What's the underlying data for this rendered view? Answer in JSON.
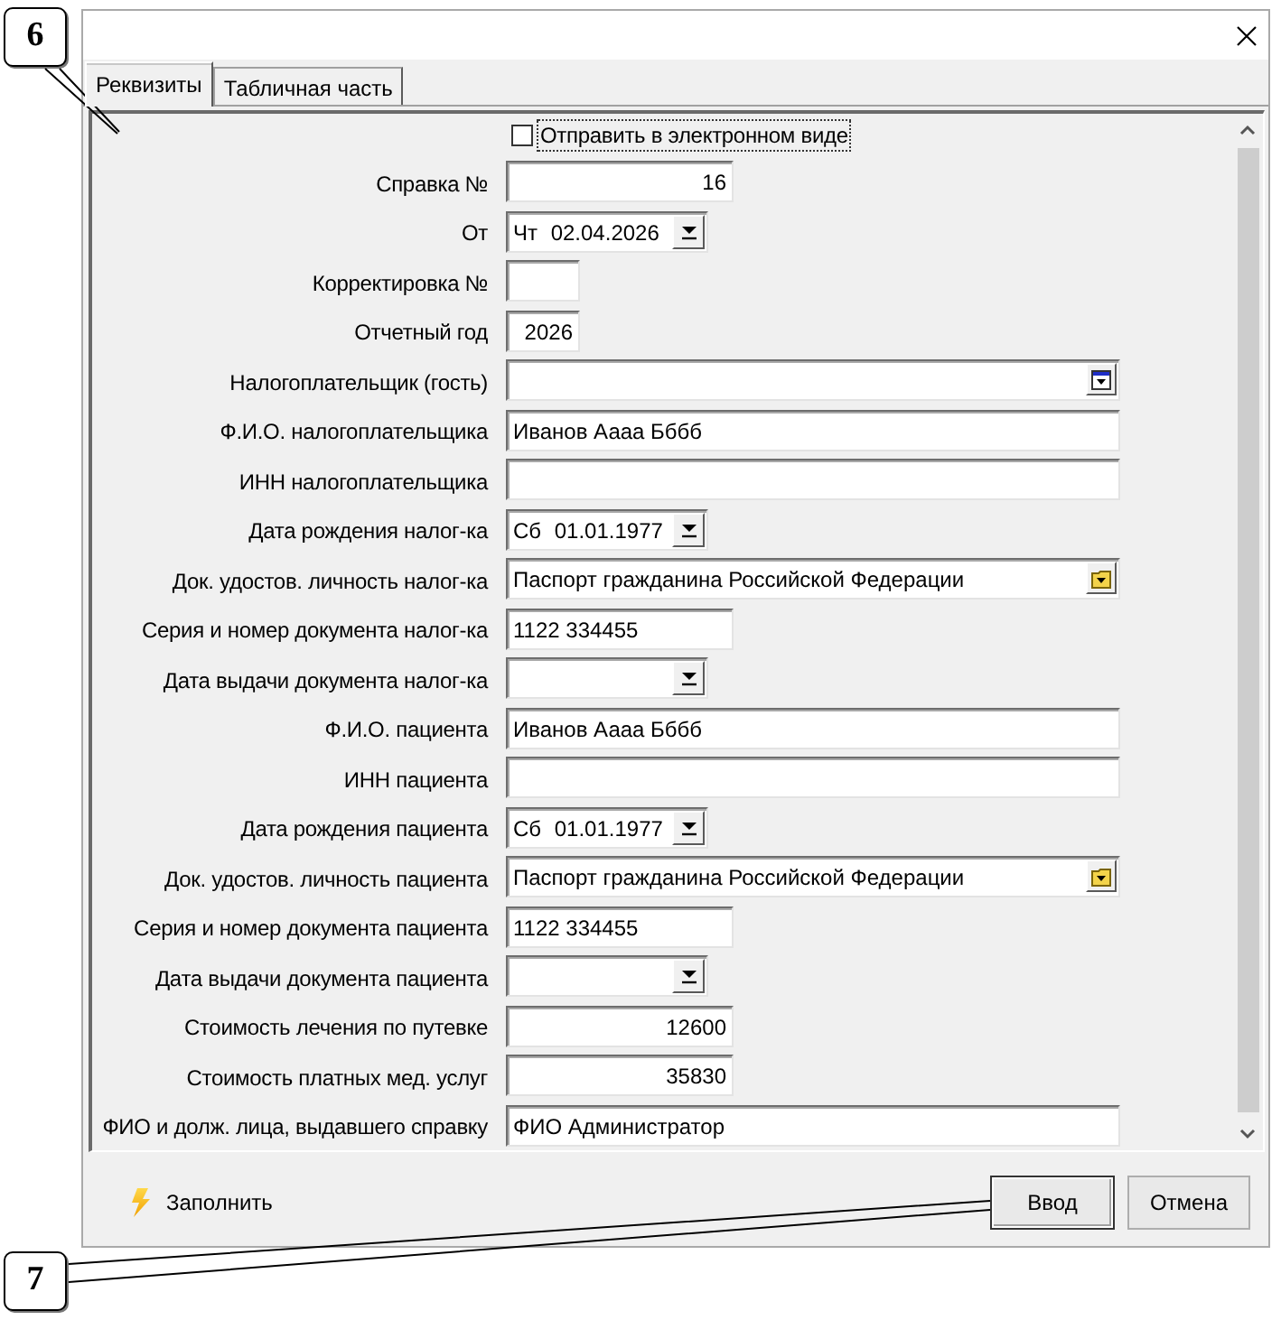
{
  "tabs": [
    {
      "label": "Реквизиты",
      "selected": true
    },
    {
      "label": "Табличная часть",
      "selected": false
    }
  ],
  "send_electronically": {
    "label": "Отправить в электронном виде",
    "checked": false,
    "focused": true
  },
  "fields": [
    {
      "kind": "number",
      "label": "Справка №",
      "value": "16"
    },
    {
      "kind": "date",
      "label": "От",
      "value": "Чт 02.04.2026"
    },
    {
      "kind": "small_number",
      "label": "Корректировка №"
    },
    {
      "kind": "small_number",
      "label": "Отчетный год",
      "value": "2026"
    },
    {
      "kind": "select",
      "label": "Налогоплательщик (гость)"
    },
    {
      "kind": "text",
      "label": "Ф.И.О. налогоплательщика",
      "value": "Иванов Аааа Бббб"
    },
    {
      "kind": "text",
      "label": "ИНН налогоплательщика"
    },
    {
      "kind": "date",
      "label": "Дата рождения налог-ка",
      "value": "Сб 01.01.1977"
    },
    {
      "kind": "reference",
      "label": "Док. удостов. личность налог-ка",
      "value": "Паспорт гражданина Российской Федерации"
    },
    {
      "kind": "series",
      "label": "Серия и номер документа налог-ка",
      "value": "1122 334455"
    },
    {
      "kind": "date",
      "label": "Дата выдачи документа налог-ка"
    },
    {
      "kind": "text",
      "label": "Ф.И.О. пациента",
      "value": "Иванов Аааа Бббб"
    },
    {
      "kind": "text",
      "label": "ИНН пациента"
    },
    {
      "kind": "date",
      "label": "Дата рождения пациента",
      "value": "Сб 01.01.1977"
    },
    {
      "kind": "reference",
      "label": "Док. удостов. личность пациента",
      "value": "Паспорт гражданина Российской Федерации"
    },
    {
      "kind": "series",
      "label": "Серия и номер документа пациента",
      "value": "1122 334455"
    },
    {
      "kind": "date",
      "label": "Дата выдачи документа пациента"
    },
    {
      "kind": "number",
      "label": "Стоимость лечения по путевке",
      "value": "12600"
    },
    {
      "kind": "number",
      "label": "Стоимость платных мед. услуг",
      "value": "35830"
    },
    {
      "kind": "text",
      "label": "ФИО и долж. лица, выдавшего справку",
      "value": "ФИО Администратор"
    }
  ],
  "footer": {
    "fill": {
      "label": "Заполнить"
    },
    "buttons": [
      {
        "label": "Ввод",
        "default": true
      },
      {
        "label": "Отмена",
        "default": false
      }
    ]
  },
  "callouts": [
    {
      "label": "6"
    },
    {
      "label": "7"
    }
  ]
}
